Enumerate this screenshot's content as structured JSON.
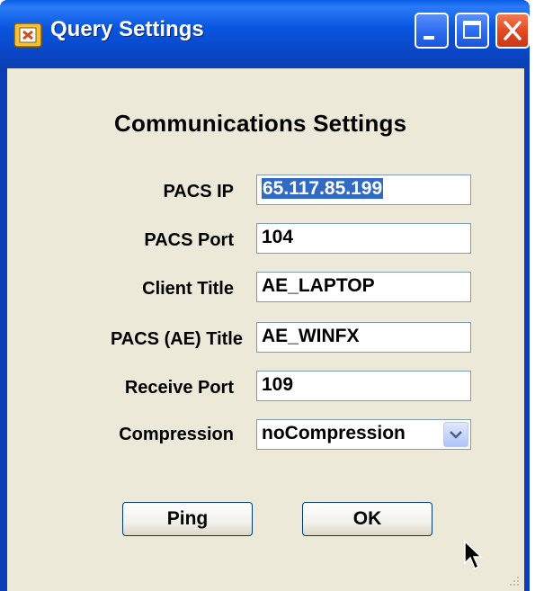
{
  "window": {
    "title": "Query Settings"
  },
  "form": {
    "heading": "Communications Settings",
    "fields": [
      {
        "label": "PACS IP",
        "value": "65.117.85.199"
      },
      {
        "label": "PACS Port",
        "value": "104"
      },
      {
        "label": "Client Title",
        "value": "AE_LAPTOP"
      },
      {
        "label": "PACS (AE) Title",
        "value": "AE_WINFX"
      },
      {
        "label": "Receive Port",
        "value": "109"
      }
    ],
    "compression": {
      "label": "Compression",
      "selected": "noCompression"
    }
  },
  "buttons": {
    "ping": "Ping",
    "ok": "OK"
  },
  "colors": {
    "titlebar": "#0a56e0",
    "client_bg": "#ece9d8",
    "selection": "#316ac5"
  }
}
